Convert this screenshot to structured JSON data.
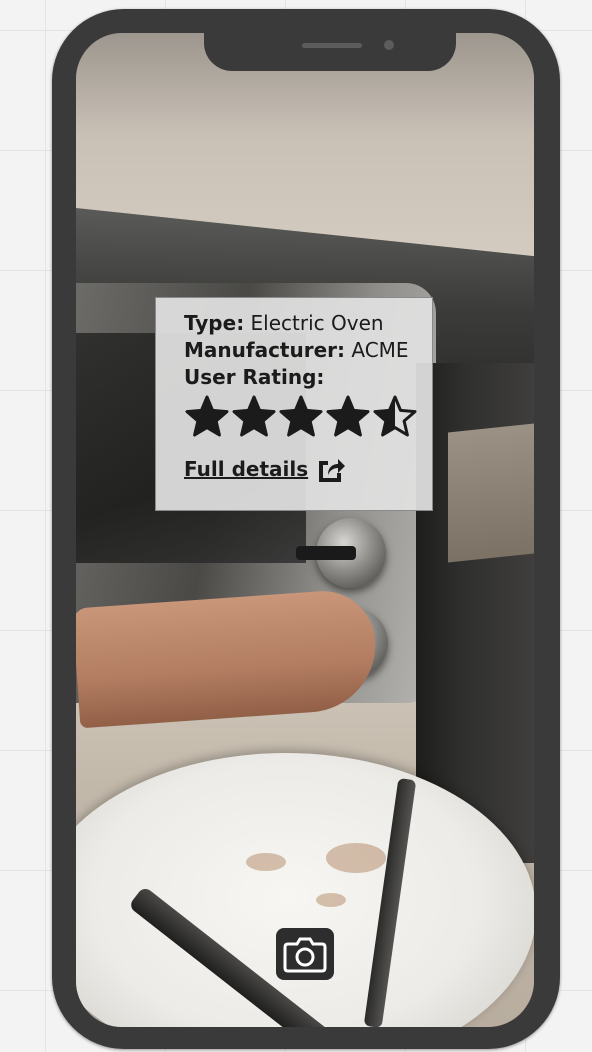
{
  "info_card": {
    "type_label": "Type:",
    "type_value": "Electric Oven",
    "manufacturer_label": "Manufacturer:",
    "manufacturer_value": "ACME",
    "rating_label": "User Rating:",
    "rating_value": 4.5,
    "rating_max": 5,
    "details_link": "Full details",
    "details_icon": "share-external-icon"
  },
  "camera": {
    "shutter_icon": "camera-icon"
  },
  "colors": {
    "phone_frame": "#3a3a3a",
    "card_background": "#e1e1e1",
    "text": "#1b1b1b"
  }
}
